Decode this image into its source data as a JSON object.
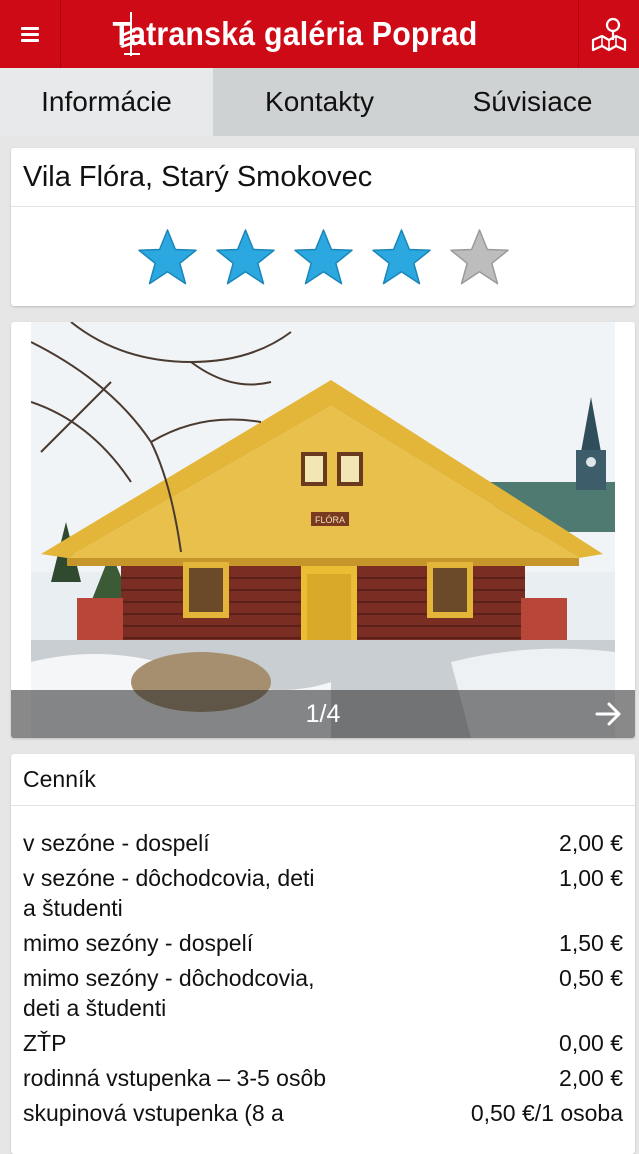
{
  "header": {
    "title": "Tatranská galéria Poprad",
    "menu_icon": "hamburger-icon",
    "logo_icon": "tower-logo-icon",
    "map_icon": "map-pin-icon",
    "color": "#cf0a17"
  },
  "tabs": [
    {
      "label": "Informácie",
      "active": true
    },
    {
      "label": "Kontakty",
      "active": false
    },
    {
      "label": "Súvisiace",
      "active": false
    }
  ],
  "place": {
    "title": "Vila Flóra, Starý Smokovec",
    "rating": 4,
    "rating_max": 5,
    "star_color": "#2ba8e0",
    "star_empty_color": "#bdbdbd"
  },
  "gallery": {
    "counter": "1/4",
    "next_icon": "arrow-right-icon",
    "sign_text": "FLÓRA"
  },
  "prices": {
    "heading": "Cenník",
    "rows": [
      {
        "label": "v sezóne - dospelí",
        "value": "2,00 €"
      },
      {
        "label": "v sezóne - dôchodcovia, deti a študenti",
        "value": "1,00 €"
      },
      {
        "label": "mimo sezóny - dospelí",
        "value": "1,50 €"
      },
      {
        "label": "mimo sezóny - dôchodcovia, deti a študenti",
        "value": "0,50 €"
      },
      {
        "label": "ZŤP",
        "value": "0,00 €"
      },
      {
        "label": "rodinná vstupenka – 3-5 osôb",
        "value": "2,00 €"
      },
      {
        "label": "skupinová vstupenka (8 a",
        "value": "0,50 €/1 osoba"
      }
    ]
  }
}
